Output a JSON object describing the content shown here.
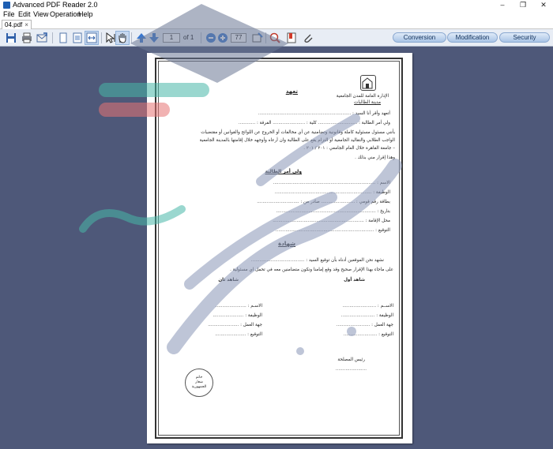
{
  "window": {
    "title": "Advanced PDF Reader 2.0",
    "controls": [
      "–",
      "❐",
      "✕"
    ]
  },
  "menu": [
    "File",
    "Edit",
    "View",
    "Operation",
    "Help"
  ],
  "tab": {
    "label": "04.pdf",
    "close": "×"
  },
  "toolbar": {
    "page_value": "1",
    "page_total": "of 1",
    "zoom_value": "77",
    "buttons": {
      "conversion": "Conversion",
      "modification": "Modification",
      "security": "Security"
    }
  },
  "colors": {
    "viewer_bg": "#4e5879",
    "accent": "#1e5fb3",
    "watermark": "#8a97b8"
  },
  "document": {
    "org_line1": "الإدارة العامة للمدن الجامعية",
    "org_line2": "مدينة الطالبات",
    "title": "تعهد",
    "line1": "أتعهد وأقر أنا السيد : ..................................................................",
    "line2": "ولي أمر الطالبة : ............................ كلية : ....................... الفرقة : ............",
    "line3": "بأنني مسئول مسئولية كاملة وقانونية وتضامنية عن أي مخالفات أو الخروج عن اللوائح والقوانين أو مقتضيات",
    "line4": "الواجب الطلابي والتقاليد الجامعية أو التزام يقع على الطالبة وان أرعاه وأوجهه خلال إقامتها بالمدينة الجامعية",
    "line5": "– جامعة القاهرة خلال العام الجامعي : ٢٠١ / ٢٠١ .",
    "line6": "وهذا إقرار مني بذلك .",
    "guardian_title": "ولي أمر الطالبة",
    "g_name": "الاسم : .........................................................................",
    "g_job": "الوظيفة : .....................................................................",
    "g_id": "بطاقة رقم قومي : ........................ صادر من : ..............................",
    "g_date": "بتاريخ : .......................................................................",
    "g_address": "محل الإقامة : .................................................................",
    "g_signature": "التوقيع : ......................................................................",
    "witness_title": "شهادة",
    "w_line1": "نشهد نحن الموقعين أدناه بأن توقيع السيد : ......................................",
    "w_line2": "على ماجاء بهذا الإقرار صحيح وقد وقع إمامنا ونكون متضامنين معه في تحمل اي مسئولية .",
    "first_witness": "شاهد أول",
    "second_witness": "شاهد ثان",
    "w1_fields": [
      "الاســم : ........................",
      "الوظيفة : ........................",
      "جهة العمل : ........................",
      "التوقيع : ........................"
    ],
    "w2_fields": [
      "الاسـم : ......................",
      "الوظيفة : ......................",
      "جهة العمل : ......................",
      "التوقيع : ......................"
    ],
    "hall_head": "رئيس المصلحة",
    "hall_dots": "......................",
    "stamp_text": "خاتم\nشعار\nالجمهورية"
  }
}
